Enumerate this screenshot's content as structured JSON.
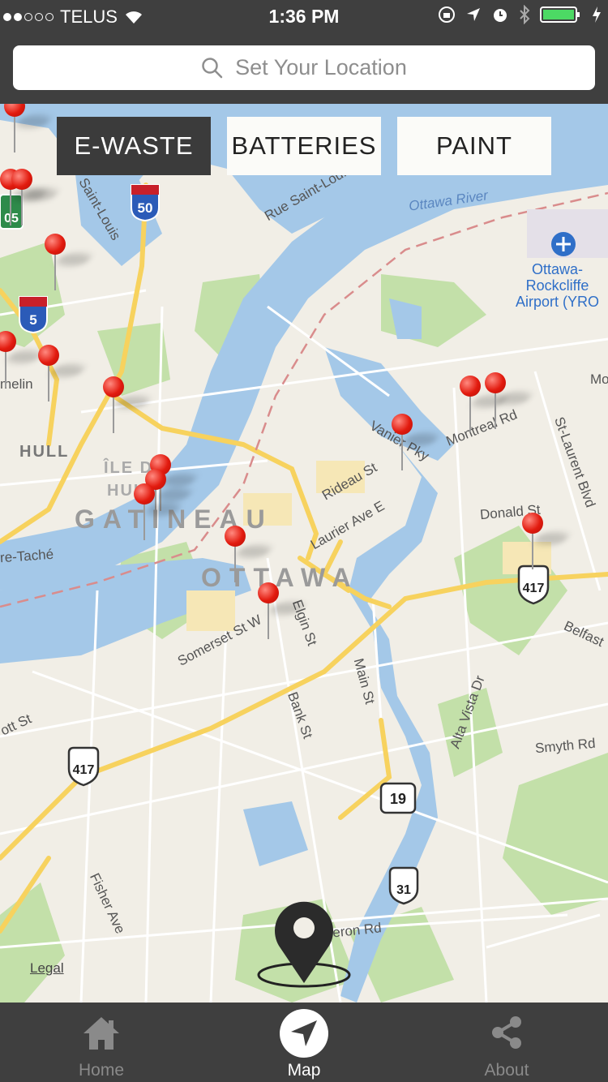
{
  "status": {
    "carrier": "TELUS",
    "time": "1:36 PM",
    "signal_bars": 2
  },
  "search": {
    "placeholder": "Set Your Location"
  },
  "filters": [
    {
      "label": "E-WASTE",
      "active": true
    },
    {
      "label": "BATTERIES",
      "active": false
    },
    {
      "label": "PAINT",
      "active": false
    }
  ],
  "map": {
    "places": {
      "ottawa_river": "Ottawa River",
      "airport_line1": "Ottawa-",
      "airport_line2": "Rockcliffe",
      "airport_line3": "Airport (YRO",
      "rue_saint": "Rue Saint-Louis",
      "saint_louis": "Saint-Louis",
      "hull": "HULL",
      "ile_de_hull_1": "ÎLE DE",
      "ile_de_hull_2": "HULL",
      "gatineau": "GATINEAU",
      "ottawa": "OTTAWA",
      "taché": "re-Taché",
      "hamelin": "melin",
      "vanier": "Vanier Pky",
      "montreal": "Montreal Rd",
      "rideau": "Rideau St",
      "laurier": "Laurier Ave E",
      "donald": "Donald St",
      "st_laurent": "St-Laurent Blvd",
      "belfast": "Belfast",
      "somerset": "Somerset St W",
      "elgin": "Elgin St",
      "main": "Main St",
      "bank": "Bank St",
      "alta_vista": "Alta Vista Dr",
      "smyth": "Smyth Rd",
      "scott": "ott St",
      "fisher": "Fisher Ave",
      "heron": "Heron Rd",
      "mo": "Mo"
    },
    "shields": {
      "hwy50": "50",
      "hwy5": "5",
      "hwy105": "05",
      "hwy417_east": "417",
      "hwy417_west": "417",
      "hwy19": "19",
      "hwy31": "31"
    },
    "legal": "Legal",
    "pins_count": 15,
    "colors": {
      "pin": "#e21b0f",
      "water": "#a4c8e8",
      "park": "#bfe0a7",
      "road": "#f9d35a"
    }
  },
  "tabs": [
    {
      "label": "Home",
      "active": false,
      "icon": "home-icon"
    },
    {
      "label": "Map",
      "active": true,
      "icon": "navigation-arrow-icon"
    },
    {
      "label": "About",
      "active": false,
      "icon": "share-icon"
    }
  ]
}
